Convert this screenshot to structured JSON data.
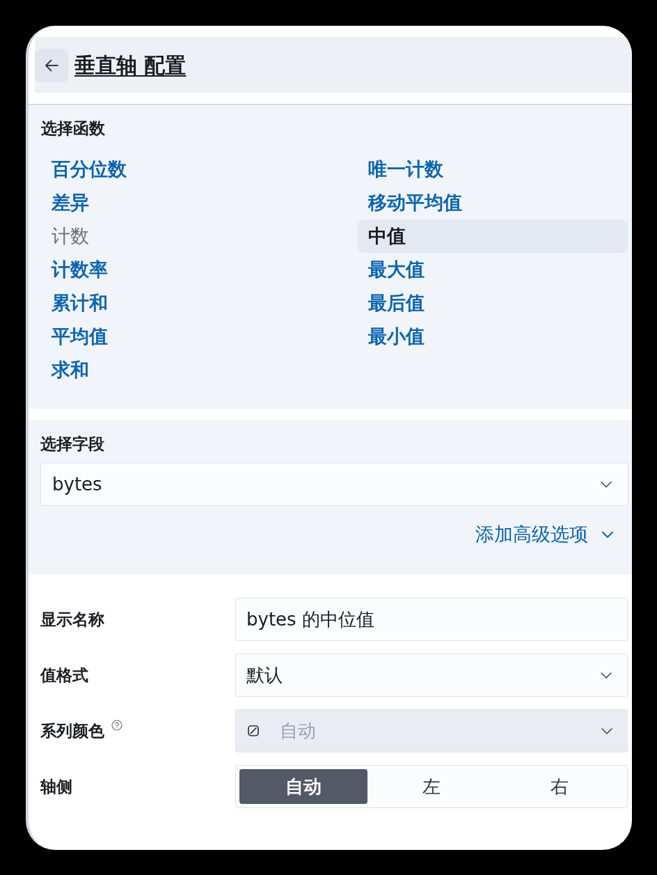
{
  "header": {
    "title": "垂直轴 配置"
  },
  "function_section": {
    "label": "选择函数",
    "functions": [
      {
        "label": "百分位数",
        "selected": false,
        "disabled": false
      },
      {
        "label": "差异",
        "selected": false,
        "disabled": false
      },
      {
        "label": "计数",
        "selected": false,
        "disabled": true
      },
      {
        "label": "计数率",
        "selected": false,
        "disabled": false
      },
      {
        "label": "累计和",
        "selected": false,
        "disabled": false
      },
      {
        "label": "平均值",
        "selected": false,
        "disabled": false
      },
      {
        "label": "求和",
        "selected": false,
        "disabled": false
      },
      {
        "label": "唯一计数",
        "selected": false,
        "disabled": false
      },
      {
        "label": "移动平均值",
        "selected": false,
        "disabled": false
      },
      {
        "label": "中值",
        "selected": true,
        "disabled": false
      },
      {
        "label": "最大值",
        "selected": false,
        "disabled": false
      },
      {
        "label": "最后值",
        "selected": false,
        "disabled": false
      },
      {
        "label": "最小值",
        "selected": false,
        "disabled": false
      }
    ]
  },
  "field_section": {
    "label": "选择字段",
    "field": {
      "value": "bytes"
    },
    "advanced_link": "添加高级选项"
  },
  "settings": [
    {
      "kind": "text",
      "label": "显示名称",
      "value": "bytes 的中位值"
    },
    {
      "kind": "select",
      "label": "值格式",
      "value": "默认"
    },
    {
      "kind": "color",
      "label": "系列颜色",
      "help": true,
      "placeholder": "自动"
    },
    {
      "kind": "segmented",
      "label": "轴侧",
      "options": [
        {
          "label": "自动",
          "selected": true
        },
        {
          "label": "左",
          "selected": false
        },
        {
          "label": "右",
          "selected": false
        }
      ]
    }
  ]
}
